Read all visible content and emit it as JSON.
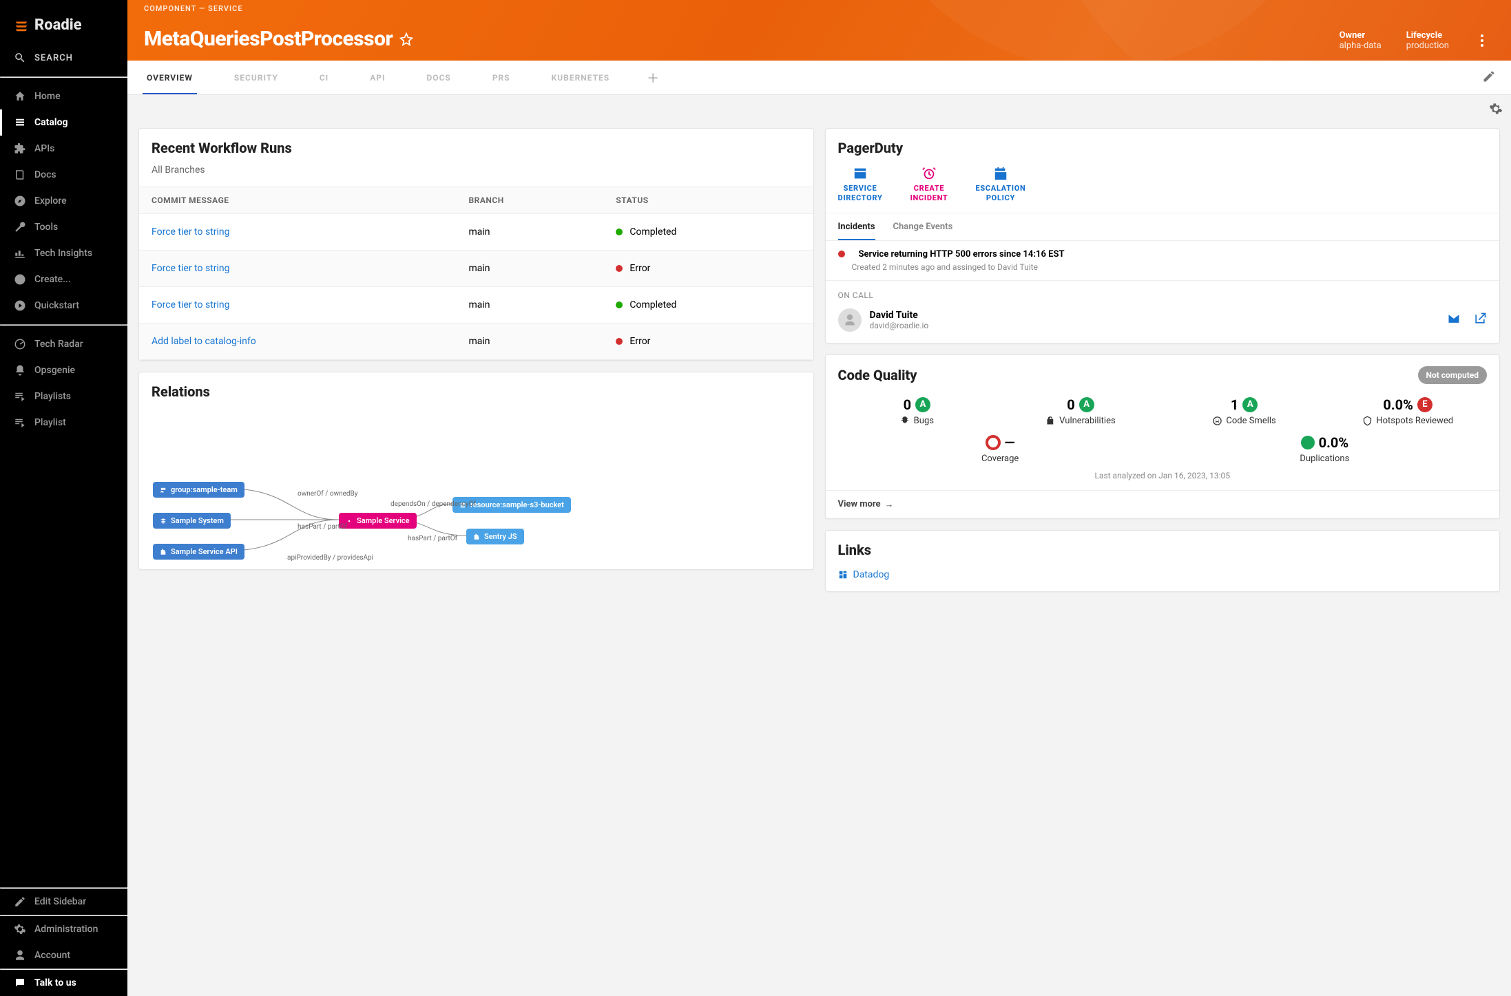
{
  "brand": "Roadie",
  "search_label": "SEARCH",
  "sidebar": {
    "items": [
      {
        "label": "Home"
      },
      {
        "label": "Catalog"
      },
      {
        "label": "APIs"
      },
      {
        "label": "Docs"
      },
      {
        "label": "Explore"
      },
      {
        "label": "Tools"
      },
      {
        "label": "Tech Insights"
      },
      {
        "label": "Create..."
      },
      {
        "label": "Quickstart"
      }
    ],
    "secondary": [
      {
        "label": "Tech Radar"
      },
      {
        "label": "Opsgenie"
      },
      {
        "label": "Playlists"
      },
      {
        "label": "Playlist"
      }
    ],
    "footer": [
      {
        "label": "Edit Sidebar"
      },
      {
        "label": "Administration"
      },
      {
        "label": "Account"
      },
      {
        "label": "Talk to us"
      }
    ]
  },
  "hero": {
    "crumb": "COMPONENT — SERVICE",
    "title": "MetaQueriesPostProcessor",
    "meta": [
      {
        "label": "Owner",
        "value": "alpha-data"
      },
      {
        "label": "Lifecycle",
        "value": "production"
      }
    ]
  },
  "tabs": [
    "OVERVIEW",
    "SECURITY",
    "CI",
    "API",
    "DOCS",
    "PRS",
    "KUBERNETES"
  ],
  "workflow": {
    "title": "Recent Workflow Runs",
    "subtitle": "All Branches",
    "columns": [
      "COMMIT MESSAGE",
      "BRANCH",
      "STATUS"
    ],
    "rows": [
      {
        "commit": "Force tier to string",
        "branch": "main",
        "status": "Completed",
        "ok": true
      },
      {
        "commit": "Force tier to string",
        "branch": "main",
        "status": "Error",
        "ok": false
      },
      {
        "commit": "Force tier to string",
        "branch": "main",
        "status": "Completed",
        "ok": true
      },
      {
        "commit": "Add label to catalog-info",
        "branch": "main",
        "status": "Error",
        "ok": false
      }
    ]
  },
  "relations": {
    "title": "Relations",
    "nodes": {
      "group": "group:sample-team",
      "system": "Sample System",
      "api": "Sample Service API",
      "service": "Sample Service",
      "bucket": "resource:sample-s3-bucket",
      "sentry": "Sentry JS"
    },
    "edges": {
      "ownerOf": "ownerOf / ownedBy",
      "hasPart1": "hasPart / partOf",
      "apiProvidedBy": "apiProvidedBy / providesApi",
      "dependsOn": "dependsOn / dependencyOf",
      "hasPart2": "hasPart / partOf"
    }
  },
  "pagerduty": {
    "title": "PagerDuty",
    "actions": [
      {
        "id": "service-directory",
        "label1": "SERVICE",
        "label2": "DIRECTORY"
      },
      {
        "id": "create-incident",
        "label1": "CREATE",
        "label2": "INCIDENT"
      },
      {
        "id": "escalation-policy",
        "label1": "ESCALATION",
        "label2": "POLICY"
      }
    ],
    "subtabs": [
      "Incidents",
      "Change Events"
    ],
    "incident": {
      "title": "Service returning HTTP 500 errors since 14:16 EST",
      "sub": "Created 2 minutes ago and assinged to David Tuite"
    },
    "oncall_label": "ON CALL",
    "oncall_name": "David Tuite",
    "oncall_email": "david@roadie.io"
  },
  "code_quality": {
    "title": "Code Quality",
    "badge": "Not computed",
    "metrics": [
      {
        "value": "0",
        "grade": "A",
        "label": "Bugs"
      },
      {
        "value": "0",
        "grade": "A",
        "label": "Vulnerabilities"
      },
      {
        "value": "1",
        "grade": "A",
        "label": "Code Smells"
      },
      {
        "value": "0.0%",
        "grade": "E",
        "label": "Hotspots Reviewed"
      }
    ],
    "coverage_val": "—",
    "coverage_label": "Coverage",
    "dup_val": "0.0%",
    "dup_label": "Duplications",
    "footer": "Last analyzed on Jan 16, 2023, 13:05",
    "view_more": "View more"
  },
  "links": {
    "title": "Links",
    "items": [
      {
        "label": "Datadog"
      }
    ]
  }
}
